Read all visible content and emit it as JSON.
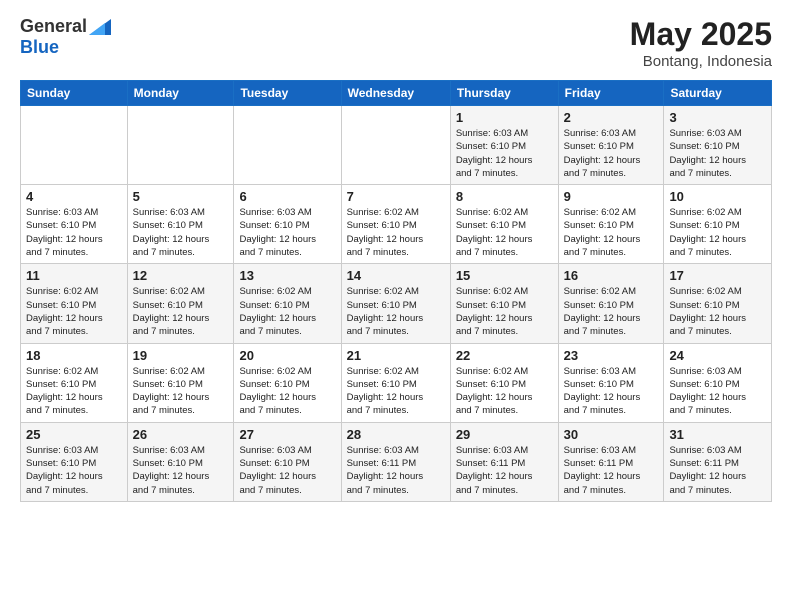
{
  "header": {
    "logo_general": "General",
    "logo_blue": "Blue",
    "month_year": "May 2025",
    "location": "Bontang, Indonesia"
  },
  "days_of_week": [
    "Sunday",
    "Monday",
    "Tuesday",
    "Wednesday",
    "Thursday",
    "Friday",
    "Saturday"
  ],
  "weeks": [
    [
      {
        "num": "",
        "info": ""
      },
      {
        "num": "",
        "info": ""
      },
      {
        "num": "",
        "info": ""
      },
      {
        "num": "",
        "info": ""
      },
      {
        "num": "1",
        "info": "Sunrise: 6:03 AM\nSunset: 6:10 PM\nDaylight: 12 hours\nand 7 minutes."
      },
      {
        "num": "2",
        "info": "Sunrise: 6:03 AM\nSunset: 6:10 PM\nDaylight: 12 hours\nand 7 minutes."
      },
      {
        "num": "3",
        "info": "Sunrise: 6:03 AM\nSunset: 6:10 PM\nDaylight: 12 hours\nand 7 minutes."
      }
    ],
    [
      {
        "num": "4",
        "info": "Sunrise: 6:03 AM\nSunset: 6:10 PM\nDaylight: 12 hours\nand 7 minutes."
      },
      {
        "num": "5",
        "info": "Sunrise: 6:03 AM\nSunset: 6:10 PM\nDaylight: 12 hours\nand 7 minutes."
      },
      {
        "num": "6",
        "info": "Sunrise: 6:03 AM\nSunset: 6:10 PM\nDaylight: 12 hours\nand 7 minutes."
      },
      {
        "num": "7",
        "info": "Sunrise: 6:02 AM\nSunset: 6:10 PM\nDaylight: 12 hours\nand 7 minutes."
      },
      {
        "num": "8",
        "info": "Sunrise: 6:02 AM\nSunset: 6:10 PM\nDaylight: 12 hours\nand 7 minutes."
      },
      {
        "num": "9",
        "info": "Sunrise: 6:02 AM\nSunset: 6:10 PM\nDaylight: 12 hours\nand 7 minutes."
      },
      {
        "num": "10",
        "info": "Sunrise: 6:02 AM\nSunset: 6:10 PM\nDaylight: 12 hours\nand 7 minutes."
      }
    ],
    [
      {
        "num": "11",
        "info": "Sunrise: 6:02 AM\nSunset: 6:10 PM\nDaylight: 12 hours\nand 7 minutes."
      },
      {
        "num": "12",
        "info": "Sunrise: 6:02 AM\nSunset: 6:10 PM\nDaylight: 12 hours\nand 7 minutes."
      },
      {
        "num": "13",
        "info": "Sunrise: 6:02 AM\nSunset: 6:10 PM\nDaylight: 12 hours\nand 7 minutes."
      },
      {
        "num": "14",
        "info": "Sunrise: 6:02 AM\nSunset: 6:10 PM\nDaylight: 12 hours\nand 7 minutes."
      },
      {
        "num": "15",
        "info": "Sunrise: 6:02 AM\nSunset: 6:10 PM\nDaylight: 12 hours\nand 7 minutes."
      },
      {
        "num": "16",
        "info": "Sunrise: 6:02 AM\nSunset: 6:10 PM\nDaylight: 12 hours\nand 7 minutes."
      },
      {
        "num": "17",
        "info": "Sunrise: 6:02 AM\nSunset: 6:10 PM\nDaylight: 12 hours\nand 7 minutes."
      }
    ],
    [
      {
        "num": "18",
        "info": "Sunrise: 6:02 AM\nSunset: 6:10 PM\nDaylight: 12 hours\nand 7 minutes."
      },
      {
        "num": "19",
        "info": "Sunrise: 6:02 AM\nSunset: 6:10 PM\nDaylight: 12 hours\nand 7 minutes."
      },
      {
        "num": "20",
        "info": "Sunrise: 6:02 AM\nSunset: 6:10 PM\nDaylight: 12 hours\nand 7 minutes."
      },
      {
        "num": "21",
        "info": "Sunrise: 6:02 AM\nSunset: 6:10 PM\nDaylight: 12 hours\nand 7 minutes."
      },
      {
        "num": "22",
        "info": "Sunrise: 6:02 AM\nSunset: 6:10 PM\nDaylight: 12 hours\nand 7 minutes."
      },
      {
        "num": "23",
        "info": "Sunrise: 6:03 AM\nSunset: 6:10 PM\nDaylight: 12 hours\nand 7 minutes."
      },
      {
        "num": "24",
        "info": "Sunrise: 6:03 AM\nSunset: 6:10 PM\nDaylight: 12 hours\nand 7 minutes."
      }
    ],
    [
      {
        "num": "25",
        "info": "Sunrise: 6:03 AM\nSunset: 6:10 PM\nDaylight: 12 hours\nand 7 minutes."
      },
      {
        "num": "26",
        "info": "Sunrise: 6:03 AM\nSunset: 6:10 PM\nDaylight: 12 hours\nand 7 minutes."
      },
      {
        "num": "27",
        "info": "Sunrise: 6:03 AM\nSunset: 6:10 PM\nDaylight: 12 hours\nand 7 minutes."
      },
      {
        "num": "28",
        "info": "Sunrise: 6:03 AM\nSunset: 6:11 PM\nDaylight: 12 hours\nand 7 minutes."
      },
      {
        "num": "29",
        "info": "Sunrise: 6:03 AM\nSunset: 6:11 PM\nDaylight: 12 hours\nand 7 minutes."
      },
      {
        "num": "30",
        "info": "Sunrise: 6:03 AM\nSunset: 6:11 PM\nDaylight: 12 hours\nand 7 minutes."
      },
      {
        "num": "31",
        "info": "Sunrise: 6:03 AM\nSunset: 6:11 PM\nDaylight: 12 hours\nand 7 minutes."
      }
    ]
  ]
}
